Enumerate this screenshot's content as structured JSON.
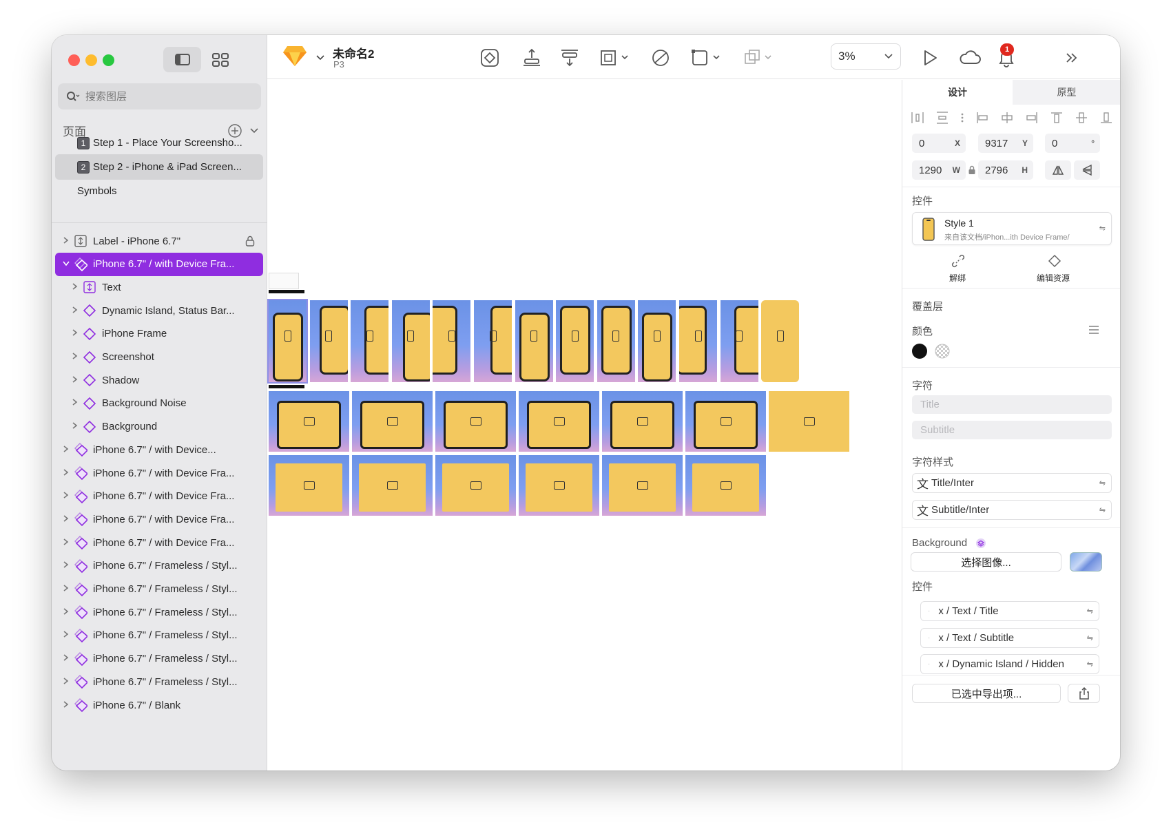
{
  "app": {
    "doc_title": "未命名2",
    "doc_subtitle": "P3"
  },
  "colors": {
    "accent": "#8f2de0",
    "sketch_yellow": "#f9b430",
    "notification": "#e0281e",
    "close": "#ff5f57",
    "minimize": "#febc2e",
    "zoom": "#28c840"
  },
  "sidebar": {
    "search_placeholder": "搜索图层",
    "pages_label": "页面",
    "pages": [
      {
        "num": "1",
        "label": "Step 1 - Place Your Screensho..."
      },
      {
        "num": "2",
        "label": "Step 2 - iPhone & iPad Screen..."
      },
      {
        "num": "",
        "label": "Symbols"
      }
    ],
    "layers": [
      {
        "label": "Label - iPhone 6.7\"",
        "icon": "text-frame-icon",
        "locked": true
      },
      {
        "label": "iPhone 6.7\" / with Device Fra...",
        "icon": "symbol-icon",
        "selected": true
      },
      {
        "label": "Text",
        "icon": "text-frame-icon",
        "child": true
      },
      {
        "label": "Dynamic Island, Status Bar...",
        "icon": "symbol-icon",
        "child": true
      },
      {
        "label": "iPhone Frame",
        "icon": "symbol-icon",
        "child": true
      },
      {
        "label": "Screenshot",
        "icon": "symbol-icon",
        "child": true
      },
      {
        "label": "Shadow",
        "icon": "symbol-icon",
        "child": true
      },
      {
        "label": "Background Noise",
        "icon": "symbol-icon",
        "child": true
      },
      {
        "label": "Background",
        "icon": "symbol-icon",
        "child": true
      },
      {
        "label": "iPhone 6.7\" / with Device...",
        "icon": "symbol-icon"
      },
      {
        "label": "iPhone 6.7\" / with Device Fra...",
        "icon": "symbol-icon"
      },
      {
        "label": "iPhone 6.7\" / with Device Fra...",
        "icon": "symbol-icon"
      },
      {
        "label": "iPhone 6.7\" / with Device Fra...",
        "icon": "symbol-icon"
      },
      {
        "label": "iPhone 6.7\" / with Device Fra...",
        "icon": "symbol-icon"
      },
      {
        "label": "iPhone 6.7\" / Frameless / Styl...",
        "icon": "symbol-icon"
      },
      {
        "label": "iPhone 6.7\" / Frameless / Styl...",
        "icon": "symbol-icon"
      },
      {
        "label": "iPhone 6.7\" / Frameless / Styl...",
        "icon": "symbol-icon"
      },
      {
        "label": "iPhone 6.7\" / Frameless / Styl...",
        "icon": "symbol-icon"
      },
      {
        "label": "iPhone 6.7\" / Frameless / Styl...",
        "icon": "symbol-icon"
      },
      {
        "label": "iPhone 6.7\" / Frameless / Styl...",
        "icon": "symbol-icon"
      },
      {
        "label": "iPhone 6.7\" / Blank",
        "icon": "symbol-icon"
      }
    ]
  },
  "toolbar": {
    "zoom": "3%",
    "notifications": "1"
  },
  "inspector": {
    "tabs": [
      "设计",
      "原型"
    ],
    "x": "0",
    "y": "9317",
    "rotation": "0",
    "w": "1290",
    "h": "2796",
    "unit_x": "X",
    "unit_y": "Y",
    "unit_rot": "°",
    "unit_w": "W",
    "unit_h": "H",
    "component_section": "控件",
    "style_name": "Style 1",
    "style_source": "来自该文档/iPhon...ith Device Frame/",
    "detach_label": "解绑",
    "edit_label": "编辑资源",
    "overrides_section": "覆盖层",
    "color_section": "颜色",
    "text_section": "字符",
    "title_placeholder": "Title",
    "subtitle_placeholder": "Subtitle",
    "text_style_section": "字符样式",
    "text_style_title": "Title/Inter",
    "text_style_subtitle": "Subtitle/Inter",
    "background_section": "Background",
    "choose_image": "选择图像...",
    "components_section": "控件",
    "component_items": [
      "x / Text / Title",
      "x / Text / Subtitle",
      "x / Dynamic Island / Hidden"
    ],
    "export_label": "已选中导出项..."
  }
}
